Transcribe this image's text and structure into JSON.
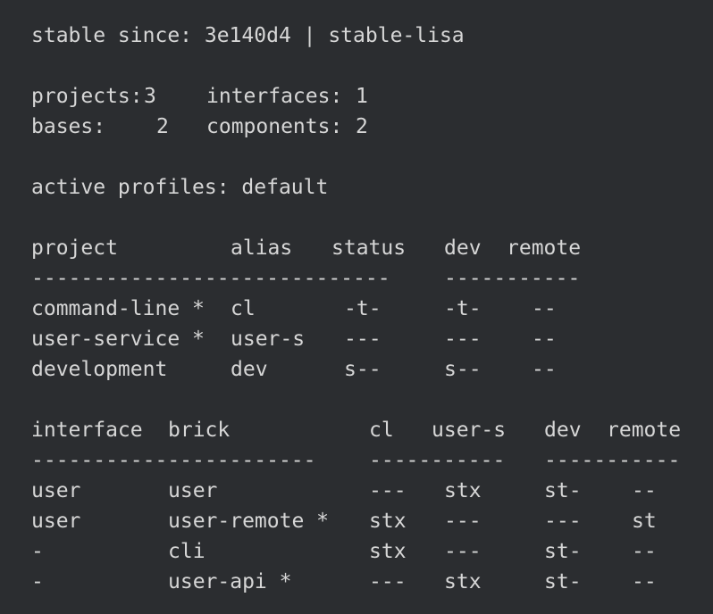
{
  "header": {
    "stable_line": "stable since: 3e140d4 | stable-lisa"
  },
  "summary": {
    "projects_label": "projects:",
    "projects_value": "3",
    "interfaces_label": "interfaces:",
    "interfaces_value": "1",
    "bases_label": "bases:",
    "bases_value": "2",
    "components_label": "components:",
    "components_value": "2"
  },
  "profiles": {
    "line": "active profiles: default"
  },
  "projects_table": {
    "headers": [
      "project",
      "alias",
      "status",
      "dev",
      "remote"
    ],
    "separator_left": "-----------------------------",
    "separator_right": "-----------",
    "rows": [
      {
        "project": "command-line *",
        "alias": "cl",
        "status": "-t-",
        "dev": "-t-",
        "remote": "--"
      },
      {
        "project": "user-service *",
        "alias": "user-s",
        "status": "---",
        "dev": "---",
        "remote": "--"
      },
      {
        "project": "development",
        "alias": "dev",
        "status": "s--",
        "dev": "s--",
        "remote": "--"
      }
    ]
  },
  "bricks_table": {
    "headers": [
      "interface",
      "brick",
      "cl",
      "user-s",
      "dev",
      "remote"
    ],
    "separator_left": "-----------------------",
    "separator_mid": "-----------",
    "separator_right": "-----------",
    "rows": [
      {
        "interface": "user",
        "brick": "user",
        "cl": "---",
        "user_s": "stx",
        "dev": "st-",
        "remote": "--"
      },
      {
        "interface": "user",
        "brick": "user-remote *",
        "cl": "stx",
        "user_s": "---",
        "dev": "---",
        "remote": "st"
      },
      {
        "interface": "-",
        "brick": "cli",
        "cl": "stx",
        "user_s": "---",
        "dev": "st-",
        "remote": "--"
      },
      {
        "interface": "-",
        "brick": "user-api *",
        "cl": "---",
        "user_s": "stx",
        "dev": "st-",
        "remote": "--"
      }
    ]
  }
}
